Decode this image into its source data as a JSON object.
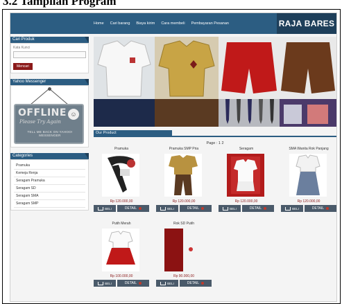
{
  "doc_heading": "3.2  Tampilan Program",
  "nav": {
    "items": [
      "Home",
      "Cari barang",
      "Biaya kirim",
      "Cara membeli",
      "Pembayaran Pesanan"
    ],
    "brand": "RAJA BARES"
  },
  "sidebar": {
    "search": {
      "title": "Cari Produk",
      "label": "Kata Kunci",
      "value": "",
      "button": "Mencari"
    },
    "messenger": {
      "title": "Yahoo Messenger",
      "sign_big": "OFFLINE",
      "sign_script": "Please Try Again",
      "sign_small": "TELL ME BACK ON YAHOO! MESSENGER"
    },
    "categories": {
      "title": "Categories",
      "items": [
        "Pramuka",
        "Kemeja Renja",
        "Seragam Pramuka",
        "Seragam SD",
        "Seragam SMA",
        "Seragam SMP"
      ]
    }
  },
  "main": {
    "section_title": "Our Product",
    "pager": "Page : 1  2",
    "buy_label": "BELI",
    "detail_label": "DETAIL",
    "products": [
      {
        "name": "Pramuka",
        "price": "Rp 120.000,00"
      },
      {
        "name": "Pramuka SMP Pria",
        "price": "Rp 120.000,00"
      },
      {
        "name": "Seragam",
        "price": "Rp 120.000,00"
      },
      {
        "name": "SMA Wanita Rok Panjang",
        "price": "Rp 120.000,00"
      },
      {
        "name": "Putih Merah",
        "price": "Rp 100.000,00"
      },
      {
        "name": "Rok SD Putih",
        "price": "Rp 90.000,00"
      }
    ]
  },
  "colors": {
    "primary": "#2c5d82",
    "primary_dark": "#1e3f5a",
    "accent_red": "#8b1a1a",
    "button_grey": "#4a5a6a"
  }
}
